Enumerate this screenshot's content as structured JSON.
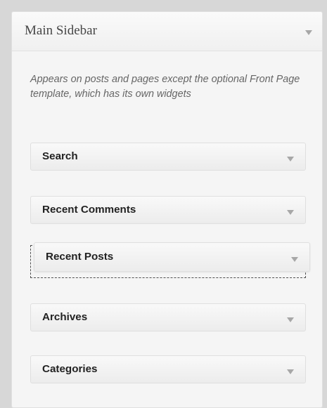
{
  "sidebar": {
    "title": "Main Sidebar",
    "description": "Appears on posts and pages except the optional Front Page template, which has its own widgets",
    "widgets": [
      {
        "label": "Search"
      },
      {
        "label": "Recent Comments"
      },
      {
        "label": "Recent Posts"
      },
      {
        "label": "Archives"
      },
      {
        "label": "Categories"
      }
    ]
  },
  "icons": {
    "toggle": "chevron-down-icon"
  },
  "colors": {
    "background": "#d7d7d7",
    "panel": "#f5f5f5",
    "widget_border": "#dfdfdf",
    "description_text": "#666666"
  }
}
